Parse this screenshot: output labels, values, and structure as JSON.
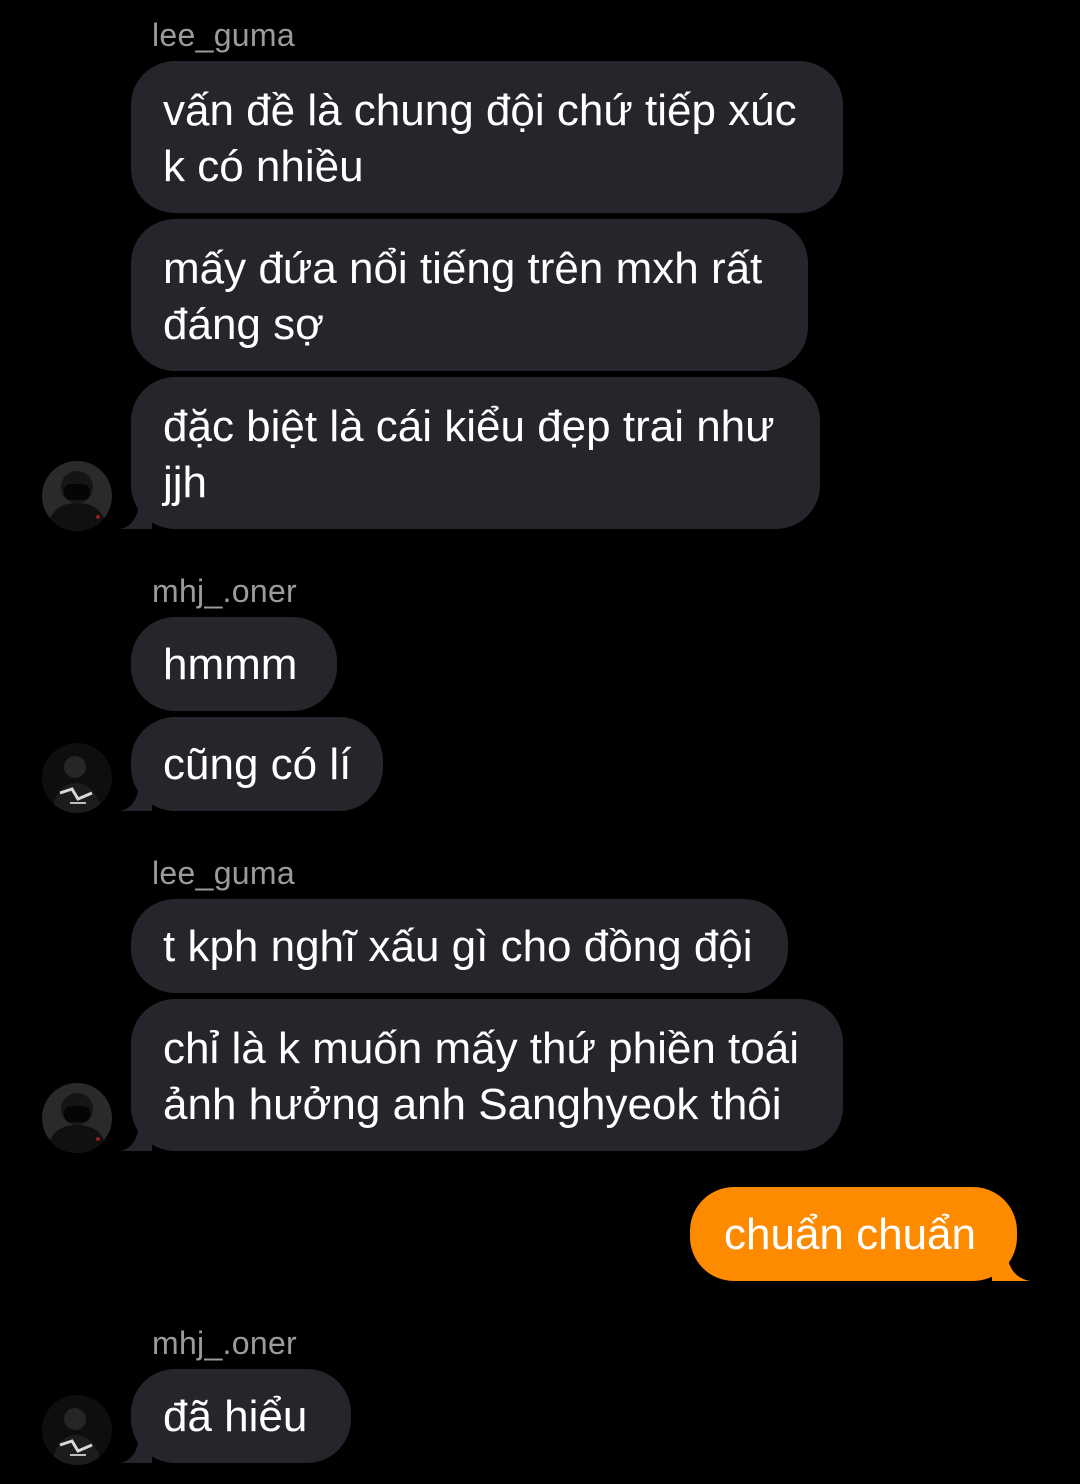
{
  "colors": {
    "background": "#000000",
    "incoming_bubble": "#26252b",
    "outgoing_bubble": "#fe8a00",
    "sender_name": "#9a9a9f",
    "text": "#ffffff"
  },
  "groups": [
    {
      "sender": "lee_guma",
      "avatar": "masked-person-avatar",
      "messages": [
        "vấn đề là chung đội chứ tiếp xúc\nk có nhiều",
        "mấy đứa nổi tiếng trên mxh rất\nđáng sợ",
        "đặc biệt là cái kiểu đẹp trai như\njjh"
      ]
    },
    {
      "sender": "mhj_.oner",
      "avatar": "dark-photo-avatar",
      "messages": [
        "hmmm",
        "cũng có lí"
      ]
    },
    {
      "sender": "lee_guma",
      "avatar": "masked-person-avatar",
      "messages": [
        "t kph nghĩ xấu gì cho đồng đội",
        "chỉ là k muốn mấy thứ phiền toái\nảnh hưởng anh Sanghyeok thôi"
      ]
    },
    {
      "sender": "",
      "outgoing": true,
      "messages": [
        "chuẩn chuẩn"
      ]
    },
    {
      "sender": "mhj_.oner",
      "avatar": "dark-photo-avatar",
      "messages": [
        "đã hiểu"
      ]
    }
  ]
}
